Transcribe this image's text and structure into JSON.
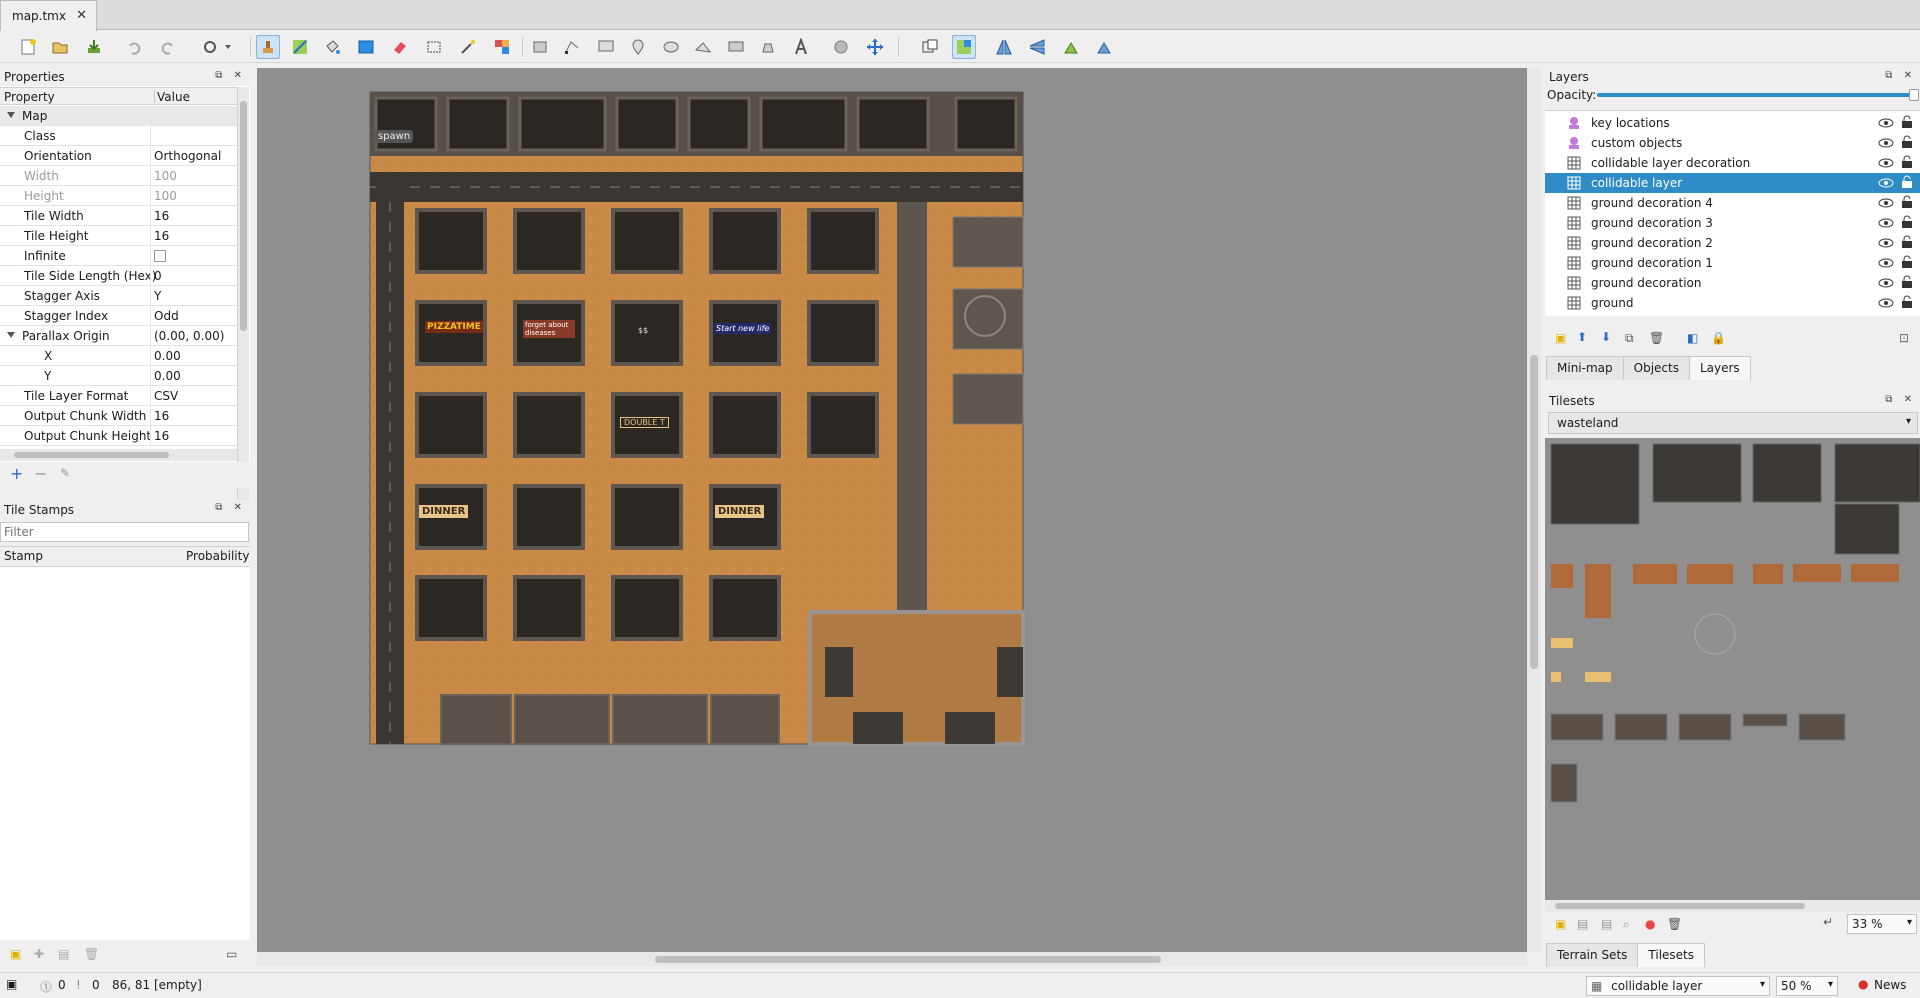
{
  "tab": {
    "title": "map.tmx"
  },
  "properties": {
    "title": "Properties",
    "col_property": "Property",
    "col_value": "Value",
    "rows": [
      {
        "k": "Map",
        "v": "",
        "type": "grp"
      },
      {
        "k": "Class",
        "v": ""
      },
      {
        "k": "Orientation",
        "v": "Orthogonal"
      },
      {
        "k": "Width",
        "v": "100",
        "type": "dim"
      },
      {
        "k": "Height",
        "v": "100",
        "type": "dim"
      },
      {
        "k": "Tile Width",
        "v": "16"
      },
      {
        "k": "Tile Height",
        "v": "16"
      },
      {
        "k": "Infinite",
        "v": "",
        "type": "check"
      },
      {
        "k": "Tile Side Length (Hex)",
        "v": "0"
      },
      {
        "k": "Stagger Axis",
        "v": "Y"
      },
      {
        "k": "Stagger Index",
        "v": "Odd"
      },
      {
        "k": "Parallax Origin",
        "v": "(0.00, 0.00)",
        "type": "grp2"
      },
      {
        "k": "X",
        "v": "0.00",
        "type": "sub"
      },
      {
        "k": "Y",
        "v": "0.00",
        "type": "sub"
      },
      {
        "k": "Tile Layer Format",
        "v": "CSV"
      },
      {
        "k": "Output Chunk Width",
        "v": "16"
      },
      {
        "k": "Output Chunk Height",
        "v": "16"
      }
    ]
  },
  "stamps": {
    "title": "Tile Stamps",
    "filter_placeholder": "Filter",
    "col_stamp": "Stamp",
    "col_probability": "Probability"
  },
  "layers": {
    "title": "Layers",
    "opacity_label": "Opacity:",
    "items": [
      {
        "name": "key locations",
        "kind": "object"
      },
      {
        "name": "custom objects",
        "kind": "object"
      },
      {
        "name": "collidable layer decoration",
        "kind": "tile"
      },
      {
        "name": "collidable layer",
        "kind": "tile",
        "selected": true
      },
      {
        "name": "ground decoration 4",
        "kind": "tile"
      },
      {
        "name": "ground decoration 3",
        "kind": "tile"
      },
      {
        "name": "ground decoration 2",
        "kind": "tile"
      },
      {
        "name": "ground decoration 1",
        "kind": "tile"
      },
      {
        "name": "ground decoration",
        "kind": "tile"
      },
      {
        "name": "ground",
        "kind": "tile"
      }
    ],
    "tabs": [
      "Mini-map",
      "Objects",
      "Layers"
    ]
  },
  "tilesets": {
    "title": "Tilesets",
    "current": "wasteland",
    "zoom": "33 %",
    "tabs": [
      "Terrain Sets",
      "Tilesets"
    ]
  },
  "map": {
    "spawn_label": "spawn",
    "signs": [
      "PIZZATIME",
      "forget about diseases",
      "$$",
      "Start new life",
      "DOUBLE T",
      "DINNER"
    ]
  },
  "status": {
    "errors": "0",
    "warnings": "0",
    "coords": "86, 81 [empty]",
    "layer": "collidable layer",
    "zoom": "50 %",
    "news": "News"
  }
}
